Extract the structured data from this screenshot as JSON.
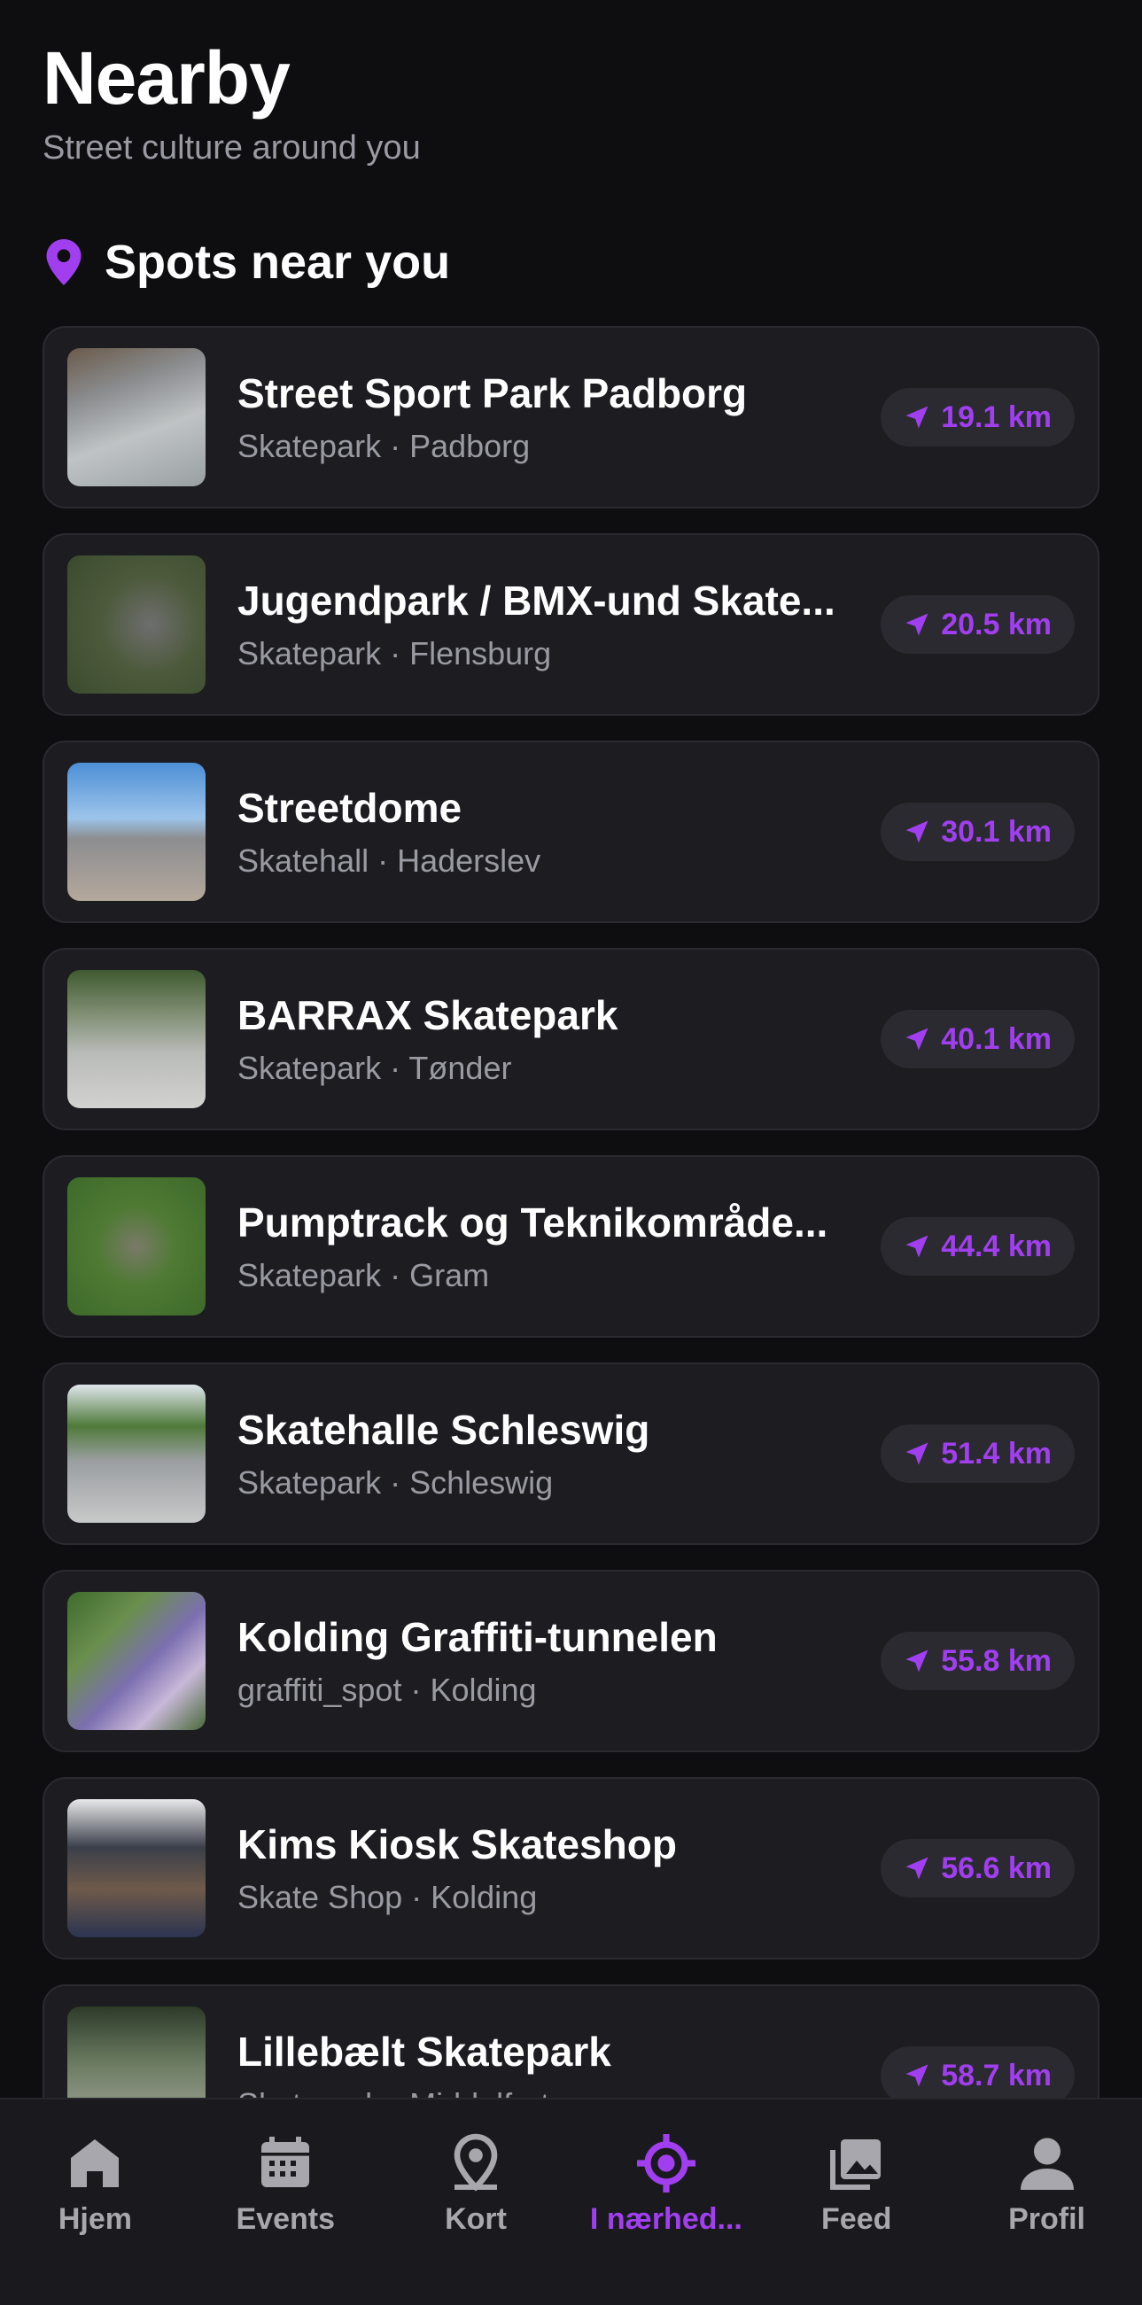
{
  "header": {
    "title": "Nearby",
    "subtitle": "Street culture around you"
  },
  "section": {
    "title": "Spots near you",
    "icon": "location-pin-icon",
    "accent": "#a13ff0"
  },
  "spots": [
    {
      "name": "Street Sport Park Padborg",
      "meta": "Skatepark · Padborg",
      "distance": "19.1 km"
    },
    {
      "name": "Jugendpark / BMX-und Skate...",
      "meta": "Skatepark · Flensburg",
      "distance": "20.5 km"
    },
    {
      "name": "Streetdome",
      "meta": "Skatehall · Haderslev",
      "distance": "30.1 km"
    },
    {
      "name": "BARRAX Skatepark",
      "meta": "Skatepark · Tønder",
      "distance": "40.1 km"
    },
    {
      "name": "Pumptrack og Teknikområde...",
      "meta": "Skatepark · Gram",
      "distance": "44.4 km"
    },
    {
      "name": "Skatehalle Schleswig",
      "meta": "Skatepark · Schleswig",
      "distance": "51.4 km"
    },
    {
      "name": "Kolding Graffiti-tunnelen",
      "meta": "graffiti_spot · Kolding",
      "distance": "55.8 km"
    },
    {
      "name": "Kims Kiosk Skateshop",
      "meta": "Skate Shop · Kolding",
      "distance": "56.6 km"
    },
    {
      "name": "Lillebælt Skatepark",
      "meta": "Skatepark · Middelfart",
      "distance": "58.7 km"
    }
  ],
  "tabs": [
    {
      "label": "Hjem",
      "icon": "home-icon"
    },
    {
      "label": "Events",
      "icon": "calendar-icon"
    },
    {
      "label": "Kort",
      "icon": "map-pin-icon"
    },
    {
      "label": "I nærhed...",
      "icon": "target-icon",
      "active": true
    },
    {
      "label": "Feed",
      "icon": "photos-icon"
    },
    {
      "label": "Profil",
      "icon": "person-icon"
    }
  ]
}
